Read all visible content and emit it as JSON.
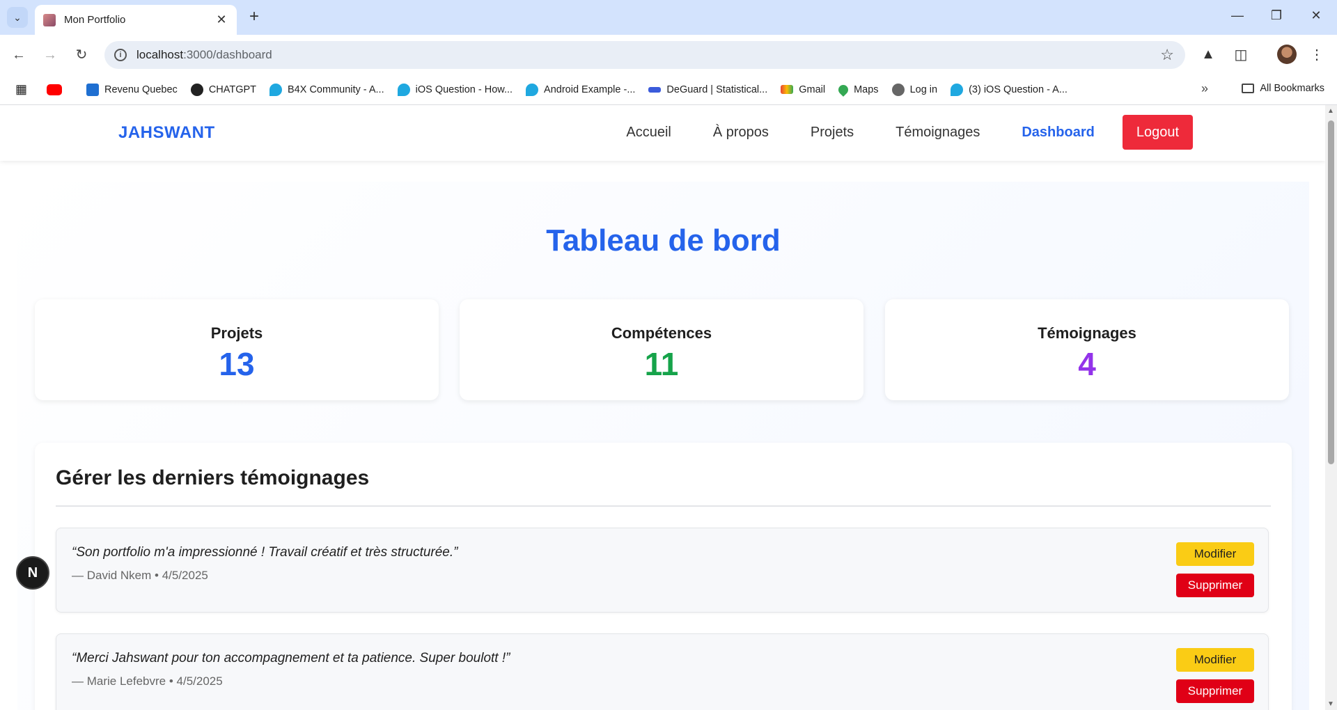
{
  "browser": {
    "tab_title": "Mon Portfolio",
    "url_host": "localhost",
    "url_path": ":3000/dashboard",
    "bookmarks": [
      {
        "label": "",
        "icon": "youtube-icon"
      },
      {
        "label": "Revenu Quebec",
        "icon": "revenu-quebec-icon"
      },
      {
        "label": "CHATGPT",
        "icon": "chatgpt-icon"
      },
      {
        "label": "B4X Community - A...",
        "icon": "b4x-icon"
      },
      {
        "label": "iOS Question - How...",
        "icon": "b4x-icon"
      },
      {
        "label": "Android Example -...",
        "icon": "b4x-icon"
      },
      {
        "label": "DeGuard | Statistical...",
        "icon": "deguard-icon"
      },
      {
        "label": "Gmail",
        "icon": "gmail-icon"
      },
      {
        "label": "Maps",
        "icon": "maps-icon"
      },
      {
        "label": "Log in",
        "icon": "globe-icon"
      },
      {
        "label": "(3) iOS Question - A...",
        "icon": "b4x-icon"
      }
    ],
    "all_bookmarks": "All Bookmarks"
  },
  "nav": {
    "brand": "JAHSWANT",
    "links": [
      "Accueil",
      "À propos",
      "Projets",
      "Témoignages",
      "Dashboard"
    ],
    "logout": "Logout"
  },
  "dashboard": {
    "title": "Tableau de bord",
    "stats": [
      {
        "label": "Projets",
        "value": "13",
        "color": "#2563eb"
      },
      {
        "label": "Compétences",
        "value": "11",
        "color": "#16a34a"
      },
      {
        "label": "Témoignages",
        "value": "4",
        "color": "#9333ea"
      }
    ],
    "manage_title": "Gérer les derniers témoignages",
    "testimonials": [
      {
        "quote": "“Son portfolio m'a impressionné ! Travail créatif et très structurée.”",
        "meta": "— David Nkem • 4/5/2025"
      },
      {
        "quote": "“Merci Jahswant pour ton accompagnement et ta patience. Super boulott !”",
        "meta": "— Marie Lefebvre • 4/5/2025"
      }
    ],
    "edit_label": "Modifier",
    "delete_label": "Supprimer"
  },
  "dev_badge": "N"
}
